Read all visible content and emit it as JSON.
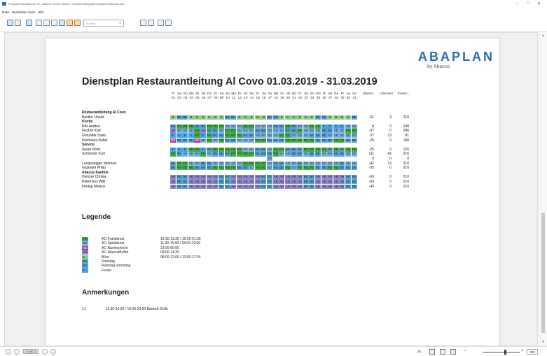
{
  "window": {
    "title": "Programmverwaltung 7/8 - Abacus Viewer [3320] - \\\\Dateien\\Abtgmpl\\Lohngleich\\abaplan.asc"
  },
  "menu": [
    "Datei",
    "Bearbeiten",
    "Seite",
    "Hilfe"
  ],
  "toolbar": {
    "search_placeholder": "Suchen"
  },
  "report": {
    "logo": "ABAPLAN",
    "logo_sub": "by Abacus",
    "title": "Dienstplan Restaurantleitung Al Covo 01.03.2019 - 31.03.2019",
    "days": [
      "Fr",
      "Sa",
      "So",
      "Mo",
      "Di",
      "Mi",
      "Do",
      "Fr",
      "Sa",
      "So",
      "Mo",
      "Di",
      "Mi",
      "Do",
      "Fr",
      "Sa",
      "So",
      "Mo",
      "Di",
      "Mi",
      "Do",
      "Fr",
      "Sa",
      "So",
      "Mo",
      "Di",
      "Mi",
      "Do",
      "Fr",
      "Sa",
      "So"
    ],
    "dates": [
      "01",
      "02",
      "03",
      "04",
      "05",
      "06",
      "07",
      "08",
      "09",
      "10",
      "11",
      "12",
      "13",
      "14",
      "15",
      "16",
      "17",
      "18",
      "19",
      "20",
      "21",
      "22",
      "23",
      "24",
      "25",
      "26",
      "27",
      "28",
      "29",
      "30",
      "31"
    ],
    "totals_headers": [
      "Überst...",
      "Überzeit",
      "Ferien..."
    ],
    "rows": [
      {
        "type": "group",
        "label": "Restaurantleitung Al Covo"
      },
      {
        "type": "emp",
        "label": "Beutler Ursula",
        "codes": "B BE BE B B B B B B BE BE B B B B B BE BE B B B B B B BE BE B B B B BE",
        "totals": [
          "-31",
          "2",
          "210"
        ]
      },
      {
        "type": "group",
        "label": "Küche"
      },
      {
        "type": "emp",
        "label": "Ritz Andrea",
        "codes": "BE FD FD FD BE BE FD FD FD SD SD SD FD FD SD SD SD BE BE FD BE SD SD FD FD F F F F SD SD",
        "totals": [
          "8",
          "0",
          "148"
        ]
      },
      {
        "type": "emp",
        "label": "Fischer Karl",
        "codes": "AB SD SD SD FD AB BE BE SD FD FD SD SD SD BE BE SD SD SD BE BE FD SD SD SD BE BE SD SD FD FD",
        "totals": [
          "-37",
          "0",
          "240"
        ]
      },
      {
        "type": "emp",
        "label": "Gmünder Dario",
        "codes": "F F F F FD F FD BE BE FD FD FD BE BE SD SD SD SD FD FD SD SD SD BE BE BE SD SD SD SD SD",
        "totals": [
          "57",
          "13",
          "81"
        ]
      },
      {
        "type": "emp",
        "label": "Kleinhans Rahel",
        "codes": "ND BE BE BE ND SD FD SD FD BE BE SD SD SD FD FD BE BE BE FD FD FD FD FD BE BE BE FD FD BE BE",
        "totals": [
          "-25",
          "0",
          "180"
        ]
      },
      {
        "type": "group",
        "label": "Service"
      },
      {
        "type": "emp",
        "label": "Spaar Peter",
        "codes": "F F F FD FD F BE FD FD FD FD FD SD SD BE BE SD FD FD BE BE BE FD FD FD FD BE FD BE FD FD",
        "totals": [
          "-25",
          "0",
          "126"
        ]
      },
      {
        "type": "emp",
        "label": "Schneider Kurt",
        "codes": "FD BE SD SD SD FD SD BE BE BE FD FD FD FD BE BE BE FD SD SD BE BE SD BE BE SD SD BE BE SD SD",
        "totals": [
          "111",
          "42",
          "216"
        ]
      },
      {
        "type": "emp",
        "label": "",
        "codes": "- - - - - - - - - - - - - - - - SD - - - - - - - - - - - - - -",
        "totals": [
          "0",
          "0",
          "0"
        ]
      },
      {
        "type": "emp",
        "label": "Langenegger Meinrad",
        "codes": "BE FD FD SD SD BE BE SD SD SD SD SD FD FD FD FD SD BE BE SD SD BE SD SD SD SD SD SD BE SD SD",
        "totals": [
          "-42",
          "13",
          "210"
        ]
      },
      {
        "type": "emp",
        "label": "Gigandet Philip",
        "codes": "BE FD FD FD BE BE BE FD FD FD FD BE BE SD FD FD SD BE BE FD SD FD FD FD BE BE FD FD BE BE BE",
        "totals": [
          "-35",
          "0",
          "210"
        ]
      },
      {
        "type": "group",
        "label": "Abacus Kantine"
      },
      {
        "type": "emp",
        "label": "Heinzer Christa",
        "codes": "AB BE BE AB AB AB AB AB BE BE AB AB AB AB AB BE BE AB AB AB AB AB BE BE AB AB AB AB AB BE BE",
        "totals": [
          "-60",
          "0",
          "210"
        ]
      },
      {
        "type": "emp",
        "label": "Peterhans Willi",
        "codes": "AB BE BE AB AB AB AB AB BE BE AB AB AB AB AB BE BE AB AB AB AB AB BE BE AB AB AB AB AB BE BE",
        "totals": [
          "-60",
          "0",
          "210"
        ]
      },
      {
        "type": "emp",
        "label": "Freitag Markus",
        "codes": "AB BE BE AB AB AB AB AB BE BE AB AB AB AB AB BE BE AB AB AB AB AB BE BE AB AB AB AB AB BE BE",
        "totals": [
          "-45",
          "0",
          "210"
        ]
      }
    ],
    "colors": {
      "B": "#8dcc83",
      "BE": "#59a6d8",
      "FD": "#3fb045",
      "SD": "#7fb4e6",
      "AB": "#8f8bd2",
      "ND": "#9b3fa3",
      "F": "#3ea7e6",
      "-": "#ffffff"
    },
    "legend_title": "Legende",
    "legend": [
      {
        "code": "FD",
        "label": "AC-Frühdienst",
        "time": "10:30-13:30 / 16:30-21:30"
      },
      {
        "code": "SD",
        "label": "AC-Spätdienst",
        "time": "11:30-15:00 / 18:00-23:00"
      },
      {
        "code": "ND",
        "label": "AC-Nachtschicht",
        "time": "22:00-06:00"
      },
      {
        "code": "AB",
        "label": "AC-AbacusBuffet",
        "time": "09:00-14:30"
      },
      {
        "code": "B",
        "label": "Büro",
        "time": "08:00-12:00 / 13:00-17:24"
      },
      {
        "code": "BE",
        "label": "Ruhetag",
        "time": ""
      },
      {
        "code": "BE",
        "label": "Ruhetag Vormittag",
        "time": ""
      },
      {
        "code": "F",
        "label": "Ferien",
        "time": ""
      }
    ],
    "notes_title": "Anmerkungen",
    "notes": [
      {
        "num": "1.)",
        "text": "11:30-15:00 / 16:00-23:00 Bankett Grillo"
      }
    ]
  },
  "status": {
    "page": "1 von 1",
    "page_count": "25",
    "zoom": "300"
  }
}
